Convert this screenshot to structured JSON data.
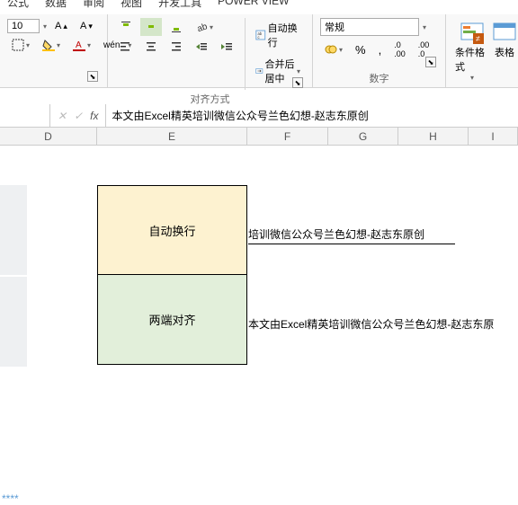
{
  "tabs": {
    "t1": "公式",
    "t2": "数据",
    "t3": "审阅",
    "t4": "视图",
    "t5": "开发工具",
    "t6": "POWER VIEW"
  },
  "font": {
    "size": "10",
    "wen": "wén"
  },
  "align": {
    "wrap": "自动换行",
    "merge": "合并后居中",
    "group": "对齐方式"
  },
  "number": {
    "format": "常规",
    "group": "数字"
  },
  "style": {
    "condfmt": "条件格式",
    "table": "表格"
  },
  "formula": {
    "fx": "fx",
    "text": "本文由Excel精英培训微信公众号兰色幻想-赵志东原创"
  },
  "cols": {
    "D": "D",
    "E": "E",
    "F": "F",
    "G": "G",
    "H": "H",
    "I": "I"
  },
  "cells": {
    "c1": "自动换行",
    "c2": "两端对齐",
    "over1": "培训微信公众号兰色幻想-赵志东原创",
    "over2": "本文由Excel精英培训微信公众号兰色幻想-赵志东原"
  },
  "stars": "****"
}
